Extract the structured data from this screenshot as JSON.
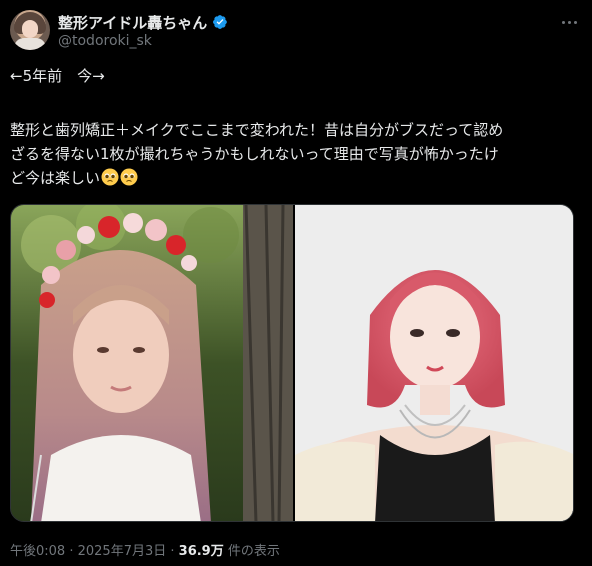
{
  "tweet": {
    "author": {
      "display_name": "整形アイドル轟ちゃん",
      "handle": "@todoroki_sk",
      "verified_color": "#1d9bf0"
    },
    "text_lines": [
      "←5年前　今→",
      "整形と歯列矯正＋メイクでここまで変われた！昔は自分がブスだって認め",
      "ざるを得ない1枚が撮れちゃうかもしれないって理由で写真が怖かったけ",
      "ど今は楽しい"
    ],
    "emojis": [
      "pleading-face-emoji",
      "pleading-face-emoji"
    ],
    "meta": {
      "time": "午後0:08",
      "sep1": " · ",
      "date": "2025年7月3日",
      "sep2": " · ",
      "views": "36.9万",
      "views_suffix": " 件の表示"
    }
  },
  "colors": {
    "background": "#000000",
    "text_primary": "#e7e9ea",
    "text_secondary": "#71767b",
    "border": "#2f3336"
  }
}
